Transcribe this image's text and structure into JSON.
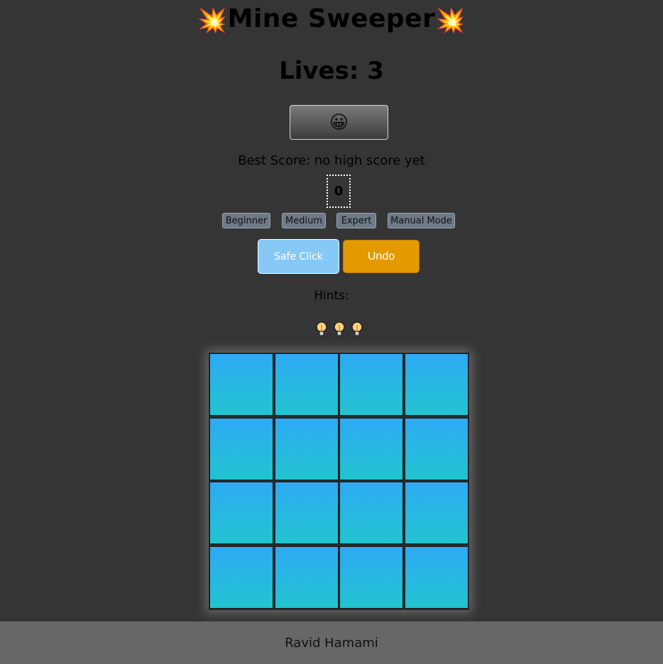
{
  "header": {
    "title": "Mine Sweeper",
    "title_icon": "💥",
    "lives_label": "Lives: 3"
  },
  "status": {
    "smiley": "😀",
    "best_score": "Best Score: no high score yet",
    "timer": "0"
  },
  "levels": [
    {
      "label": "Beginner"
    },
    {
      "label": "Medium"
    },
    {
      "label": "Expert"
    },
    {
      "label": "Manual Mode"
    }
  ],
  "actions": {
    "safe_click": "Safe Click",
    "undo": "Undo"
  },
  "hints": {
    "label": "Hints:",
    "count": 3,
    "icon": "lightbulb-icon"
  },
  "board": {
    "rows": 4,
    "cols": 4,
    "cell_state": "covered"
  },
  "footer": {
    "author": "Ravid Hamami"
  },
  "colors": {
    "background": "#353535",
    "cell_top": "#2eaaf5",
    "cell_bottom": "#22c4cf",
    "safe_click": "#86c9f6",
    "undo": "#e39a00",
    "footer": "#676767"
  }
}
